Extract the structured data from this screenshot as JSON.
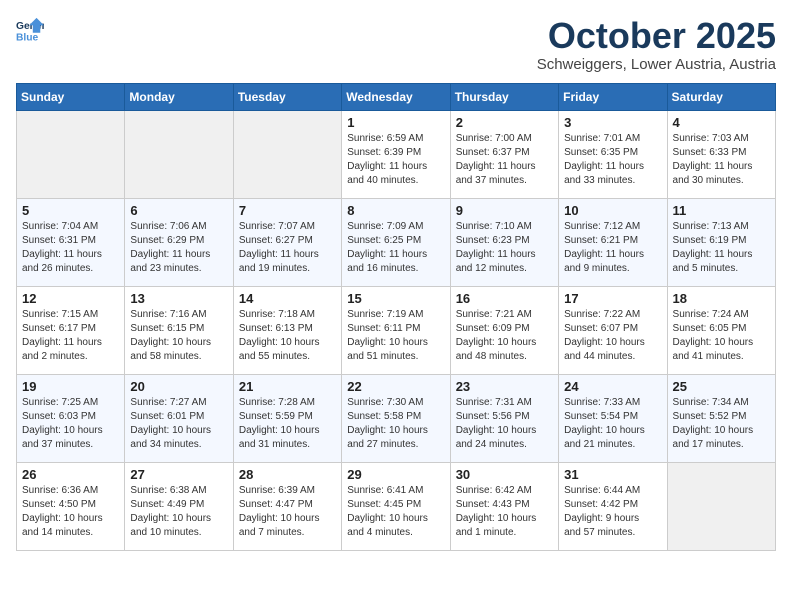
{
  "header": {
    "logo_line1": "General",
    "logo_line2": "Blue",
    "month": "October 2025",
    "location": "Schweiggers, Lower Austria, Austria"
  },
  "weekdays": [
    "Sunday",
    "Monday",
    "Tuesday",
    "Wednesday",
    "Thursday",
    "Friday",
    "Saturday"
  ],
  "weeks": [
    [
      {
        "day": "",
        "info": ""
      },
      {
        "day": "",
        "info": ""
      },
      {
        "day": "",
        "info": ""
      },
      {
        "day": "1",
        "info": "Sunrise: 6:59 AM\nSunset: 6:39 PM\nDaylight: 11 hours\nand 40 minutes."
      },
      {
        "day": "2",
        "info": "Sunrise: 7:00 AM\nSunset: 6:37 PM\nDaylight: 11 hours\nand 37 minutes."
      },
      {
        "day": "3",
        "info": "Sunrise: 7:01 AM\nSunset: 6:35 PM\nDaylight: 11 hours\nand 33 minutes."
      },
      {
        "day": "4",
        "info": "Sunrise: 7:03 AM\nSunset: 6:33 PM\nDaylight: 11 hours\nand 30 minutes."
      }
    ],
    [
      {
        "day": "5",
        "info": "Sunrise: 7:04 AM\nSunset: 6:31 PM\nDaylight: 11 hours\nand 26 minutes."
      },
      {
        "day": "6",
        "info": "Sunrise: 7:06 AM\nSunset: 6:29 PM\nDaylight: 11 hours\nand 23 minutes."
      },
      {
        "day": "7",
        "info": "Sunrise: 7:07 AM\nSunset: 6:27 PM\nDaylight: 11 hours\nand 19 minutes."
      },
      {
        "day": "8",
        "info": "Sunrise: 7:09 AM\nSunset: 6:25 PM\nDaylight: 11 hours\nand 16 minutes."
      },
      {
        "day": "9",
        "info": "Sunrise: 7:10 AM\nSunset: 6:23 PM\nDaylight: 11 hours\nand 12 minutes."
      },
      {
        "day": "10",
        "info": "Sunrise: 7:12 AM\nSunset: 6:21 PM\nDaylight: 11 hours\nand 9 minutes."
      },
      {
        "day": "11",
        "info": "Sunrise: 7:13 AM\nSunset: 6:19 PM\nDaylight: 11 hours\nand 5 minutes."
      }
    ],
    [
      {
        "day": "12",
        "info": "Sunrise: 7:15 AM\nSunset: 6:17 PM\nDaylight: 11 hours\nand 2 minutes."
      },
      {
        "day": "13",
        "info": "Sunrise: 7:16 AM\nSunset: 6:15 PM\nDaylight: 10 hours\nand 58 minutes."
      },
      {
        "day": "14",
        "info": "Sunrise: 7:18 AM\nSunset: 6:13 PM\nDaylight: 10 hours\nand 55 minutes."
      },
      {
        "day": "15",
        "info": "Sunrise: 7:19 AM\nSunset: 6:11 PM\nDaylight: 10 hours\nand 51 minutes."
      },
      {
        "day": "16",
        "info": "Sunrise: 7:21 AM\nSunset: 6:09 PM\nDaylight: 10 hours\nand 48 minutes."
      },
      {
        "day": "17",
        "info": "Sunrise: 7:22 AM\nSunset: 6:07 PM\nDaylight: 10 hours\nand 44 minutes."
      },
      {
        "day": "18",
        "info": "Sunrise: 7:24 AM\nSunset: 6:05 PM\nDaylight: 10 hours\nand 41 minutes."
      }
    ],
    [
      {
        "day": "19",
        "info": "Sunrise: 7:25 AM\nSunset: 6:03 PM\nDaylight: 10 hours\nand 37 minutes."
      },
      {
        "day": "20",
        "info": "Sunrise: 7:27 AM\nSunset: 6:01 PM\nDaylight: 10 hours\nand 34 minutes."
      },
      {
        "day": "21",
        "info": "Sunrise: 7:28 AM\nSunset: 5:59 PM\nDaylight: 10 hours\nand 31 minutes."
      },
      {
        "day": "22",
        "info": "Sunrise: 7:30 AM\nSunset: 5:58 PM\nDaylight: 10 hours\nand 27 minutes."
      },
      {
        "day": "23",
        "info": "Sunrise: 7:31 AM\nSunset: 5:56 PM\nDaylight: 10 hours\nand 24 minutes."
      },
      {
        "day": "24",
        "info": "Sunrise: 7:33 AM\nSunset: 5:54 PM\nDaylight: 10 hours\nand 21 minutes."
      },
      {
        "day": "25",
        "info": "Sunrise: 7:34 AM\nSunset: 5:52 PM\nDaylight: 10 hours\nand 17 minutes."
      }
    ],
    [
      {
        "day": "26",
        "info": "Sunrise: 6:36 AM\nSunset: 4:50 PM\nDaylight: 10 hours\nand 14 minutes."
      },
      {
        "day": "27",
        "info": "Sunrise: 6:38 AM\nSunset: 4:49 PM\nDaylight: 10 hours\nand 10 minutes."
      },
      {
        "day": "28",
        "info": "Sunrise: 6:39 AM\nSunset: 4:47 PM\nDaylight: 10 hours\nand 7 minutes."
      },
      {
        "day": "29",
        "info": "Sunrise: 6:41 AM\nSunset: 4:45 PM\nDaylight: 10 hours\nand 4 minutes."
      },
      {
        "day": "30",
        "info": "Sunrise: 6:42 AM\nSunset: 4:43 PM\nDaylight: 10 hours\nand 1 minute."
      },
      {
        "day": "31",
        "info": "Sunrise: 6:44 AM\nSunset: 4:42 PM\nDaylight: 9 hours\nand 57 minutes."
      },
      {
        "day": "",
        "info": ""
      }
    ]
  ]
}
